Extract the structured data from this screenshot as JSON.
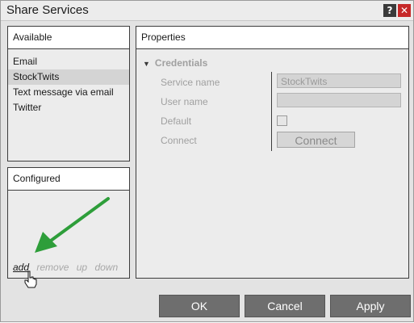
{
  "window": {
    "title": "Share Services",
    "help_label": "?",
    "close_label": "✕"
  },
  "available": {
    "header": "Available",
    "items": [
      {
        "label": "Email",
        "selected": false
      },
      {
        "label": "StockTwits",
        "selected": true
      },
      {
        "label": "Text message via email",
        "selected": false
      },
      {
        "label": "Twitter",
        "selected": false
      }
    ]
  },
  "configured": {
    "header": "Configured",
    "actions": {
      "add": "add",
      "remove": "remove",
      "up": "up",
      "down": "down"
    }
  },
  "properties": {
    "header": "Properties",
    "section_title": "Credentials",
    "service_name_label": "Service name",
    "service_name_value": "StockTwits",
    "user_name_label": "User name",
    "user_name_value": "",
    "default_label": "Default",
    "default_checked": false,
    "connect_label": "Connect",
    "connect_button": "Connect"
  },
  "buttons": {
    "ok": "OK",
    "cancel": "Cancel",
    "apply": "Apply"
  },
  "colors": {
    "annotation_arrow": "#2e9e3a",
    "button_bg": "#6e6e6e",
    "close_bg": "#c62828"
  }
}
